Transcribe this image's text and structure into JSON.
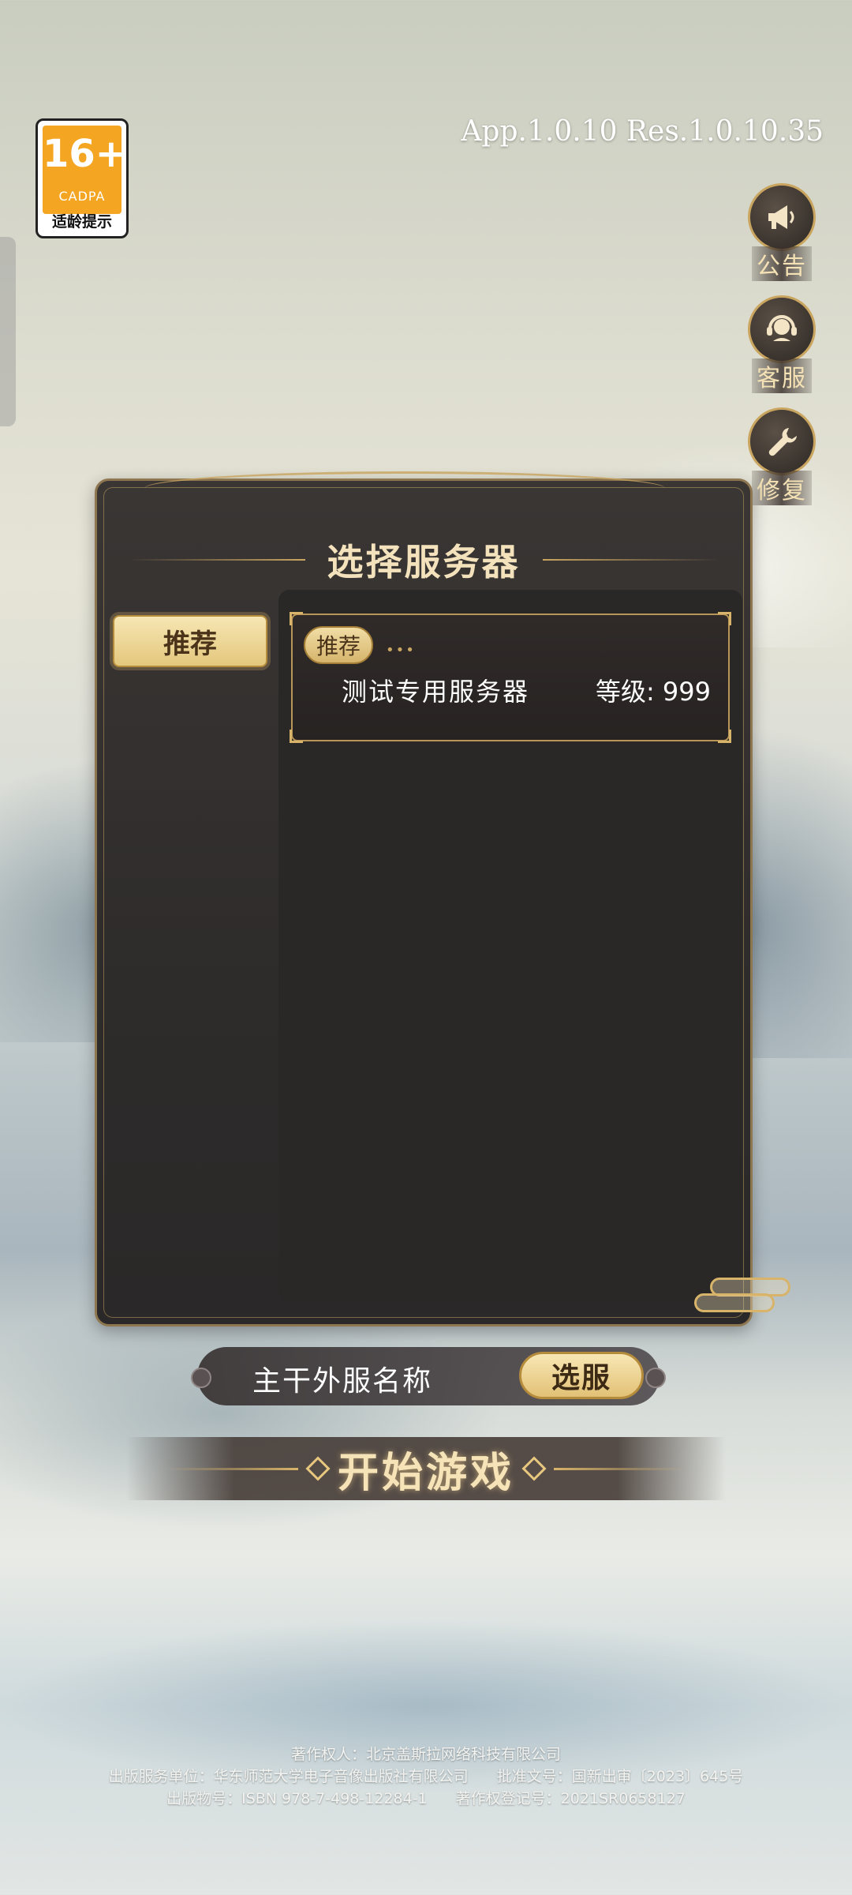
{
  "age_rating": {
    "rating": "16+",
    "org": "CADPA",
    "tip": "适龄提示"
  },
  "version_text": "App.1.0.10 Res.1.0.10.35",
  "side_buttons": [
    {
      "label": "公告",
      "icon": "megaphone-icon"
    },
    {
      "label": "客服",
      "icon": "headset-icon"
    },
    {
      "label": "修复",
      "icon": "wrench-icon"
    }
  ],
  "panel": {
    "title": "选择服务器",
    "tabs": [
      {
        "label": "推荐"
      }
    ],
    "servers": [
      {
        "tag": "推荐",
        "name": "测试专用服务器",
        "level_text": "等级: 999"
      }
    ]
  },
  "select_bar": {
    "current_server": "主干外服名称",
    "button_label": "选服"
  },
  "start_button": "开始游戏",
  "footer": {
    "line1": "著作权人：北京盖斯拉网络科技有限公司",
    "line2a": "出版服务单位：华东师范大学电子音像出版社有限公司",
    "line2b": "批准文号：国新出审〔2023〕645号",
    "line3a": "出版物号：ISBN 978-7-498-12284-1",
    "line3b": "著作权登记号：2021SR0658127"
  },
  "colors": {
    "gold": "#c9a560",
    "panel_bg": "#2e2b2b",
    "button_gold": "#e2c176"
  }
}
